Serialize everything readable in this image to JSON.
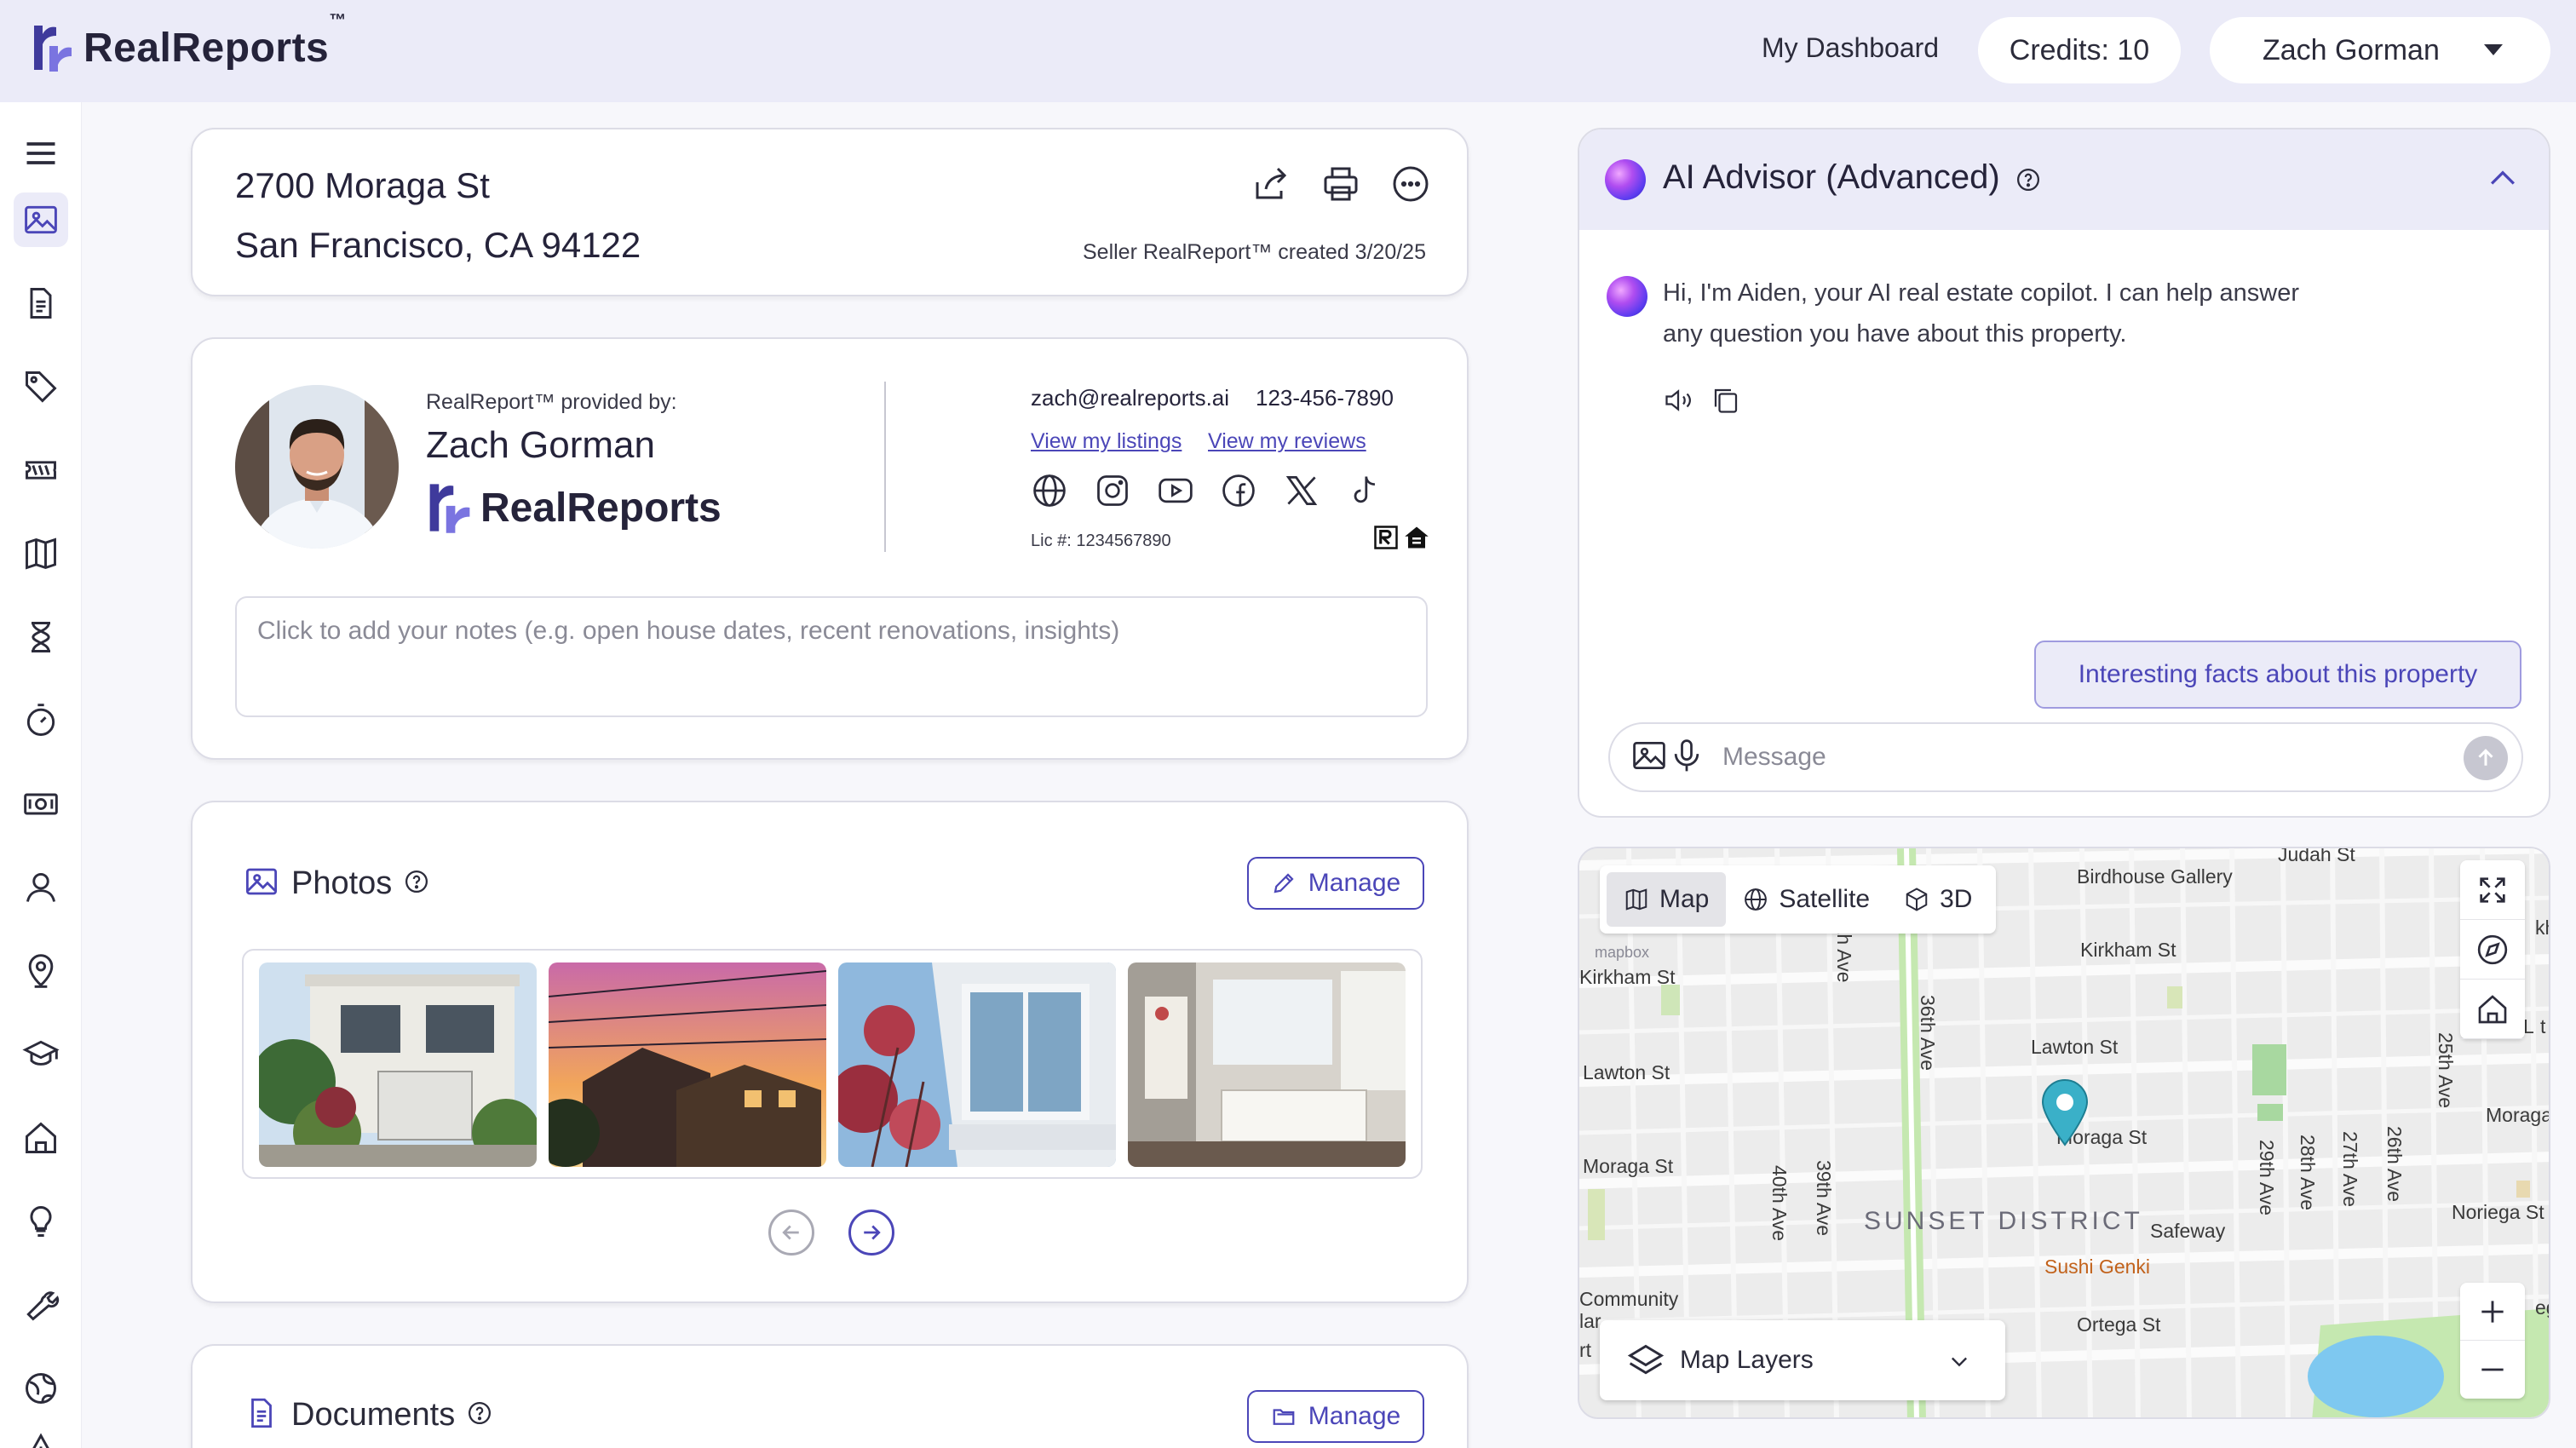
{
  "brand": {
    "name": "RealReports",
    "tm": "™"
  },
  "topbar": {
    "dashboard_link": "My Dashboard",
    "credits": "Credits: 10",
    "user_name": "Zach Gorman"
  },
  "sidebar": {
    "items": [
      {
        "name": "menu-icon"
      },
      {
        "name": "photos-icon",
        "active": true
      },
      {
        "name": "documents-icon"
      },
      {
        "name": "tag-icon"
      },
      {
        "name": "ticket-icon"
      },
      {
        "name": "map-icon"
      },
      {
        "name": "hourglass-icon"
      },
      {
        "name": "timer-icon"
      },
      {
        "name": "money-icon"
      },
      {
        "name": "person-icon"
      },
      {
        "name": "location-icon"
      },
      {
        "name": "graduation-icon"
      },
      {
        "name": "home-icon"
      },
      {
        "name": "lightbulb-icon"
      },
      {
        "name": "wrench-icon"
      },
      {
        "name": "globe-icon"
      },
      {
        "name": "warning-icon"
      }
    ]
  },
  "address": {
    "line1": "2700 Moraga St",
    "line2": "San Francisco, CA 94122",
    "created": "Seller RealReport™ created 3/20/25"
  },
  "agent": {
    "provided_by": "RealReport™ provided by:",
    "name": "Zach Gorman",
    "brokerage": "RealReports",
    "email": "zach@realreports.ai",
    "phone": "123-456-7890",
    "listings_link": "View my listings",
    "reviews_link": "View my reviews",
    "license": "Lic #: 1234567890",
    "notes_placeholder": "Click to add your notes (e.g. open house dates, recent renovations, insights)"
  },
  "photos": {
    "title": "Photos",
    "manage_label": "Manage",
    "items": [
      {
        "name": "house-front-photo"
      },
      {
        "name": "sunset-photo"
      },
      {
        "name": "window-photo"
      },
      {
        "name": "interior-photo"
      }
    ]
  },
  "documents": {
    "title": "Documents",
    "manage_label": "Manage"
  },
  "ai": {
    "title": "AI Advisor (Advanced)",
    "message": "Hi, I'm Aiden, your AI real estate copilot. I can help answer any question you have about this property.",
    "suggestion": "Interesting facts about this property",
    "input_placeholder": "Message"
  },
  "map": {
    "tabs": {
      "map": "Map",
      "satellite": "Satellite",
      "3d": "3D"
    },
    "layers_label": "Map Layers",
    "attribution": "mapbox",
    "labels": {
      "judah": "Judah St",
      "birdhouse": "Birdhouse Gallery",
      "kirkham_east": "Kirkham St",
      "kirkham_west": "Kirkham St",
      "lawton_east": "Lawton St",
      "lawton_west": "Lawton St",
      "moraga_center": "Moraga St",
      "moraga_west": "Moraga St",
      "moraga_east": "Moraga",
      "noriega": "Noriega St",
      "safeway": "Safeway",
      "sushi": "Sushi Genki",
      "ortega": "Ortega St",
      "community": "Community",
      "district": "SUNSET DISTRICT",
      "ave_36": "36th Ave",
      "ave_40": "40th Ave",
      "ave_39": "39th Ave",
      "ave_th": "th Ave",
      "ave_29": "29th Ave",
      "ave_28": "28th Ave",
      "ave_27": "27th Ave",
      "ave_26": "26th Ave",
      "ave_25": "25th Ave",
      "frag_kh": "kh",
      "frag_l": "L",
      "frag_t": "t",
      "frag_eg": "eg",
      "frag_lar": "lar",
      "frag_rt": "rt"
    }
  }
}
